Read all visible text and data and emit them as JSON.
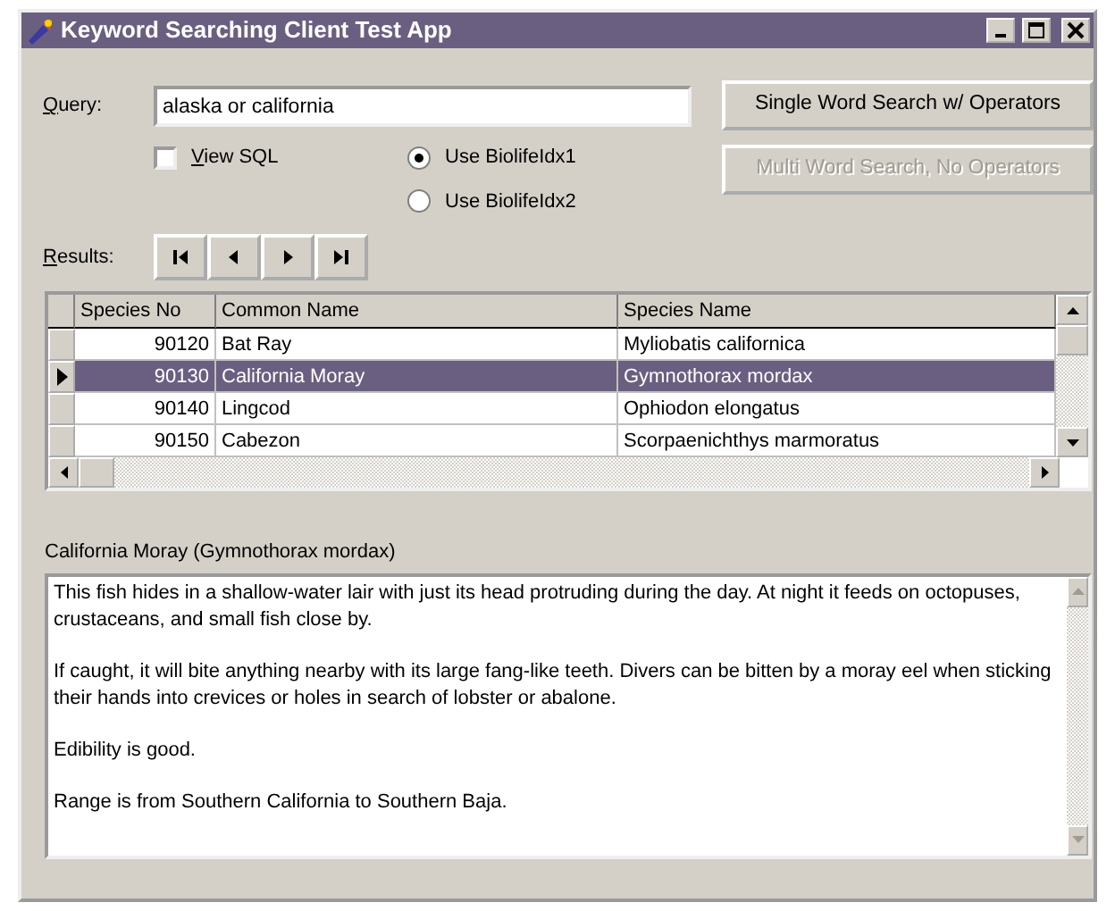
{
  "window": {
    "title": "Keyword Searching Client Test App"
  },
  "query": {
    "label": "Query:",
    "value": "alaska or california"
  },
  "view_sql": {
    "label": "View SQL",
    "checked": false
  },
  "index_options": [
    {
      "label": "Use BiolifeIdx1",
      "selected": true
    },
    {
      "label": "Use BiolifeIdx2",
      "selected": false
    }
  ],
  "buttons": [
    {
      "label": "Single Word Search w/ Operators",
      "disabled": false
    },
    {
      "label": "Multi Word Search, No Operators",
      "disabled": true
    }
  ],
  "results": {
    "label": "Results:"
  },
  "table": {
    "columns": [
      "Species No",
      "Common Name",
      "Species Name"
    ],
    "rows": [
      {
        "cells": [
          "90120",
          "Bat Ray",
          "Myliobatis californica"
        ],
        "selected": false
      },
      {
        "cells": [
          "90130",
          "California Moray",
          "Gymnothorax mordax"
        ],
        "selected": true
      },
      {
        "cells": [
          "90140",
          "Lingcod",
          "Ophiodon elongatus"
        ],
        "selected": false
      },
      {
        "cells": [
          "90150",
          "Cabezon",
          "Scorpaenichthys marmoratus"
        ],
        "selected": false
      }
    ]
  },
  "detail": {
    "heading": "California Moray (Gymnothorax mordax)",
    "paragraphs": [
      "This fish hides in a shallow-water lair with just its head protruding during the day.  At night it feeds on octopuses, crustaceans, and small fish close by.",
      "If caught, it will bite anything nearby with its large fang-like teeth.  Divers can be bitten by a moray eel when sticking their hands into crevices or holes in search of lobster or abalone.",
      "Edibility is good.",
      "Range is from Southern California to Southern Baja."
    ]
  }
}
